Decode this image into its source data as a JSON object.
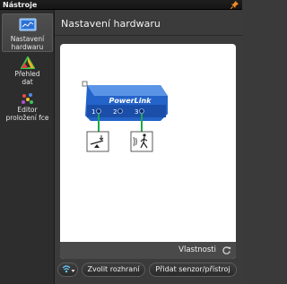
{
  "panel": {
    "title": "Nástroje"
  },
  "sidebar": {
    "items": [
      {
        "label": "Nastavení hardwaru",
        "icon": "hardware-settings-icon",
        "active": true
      },
      {
        "label": "Přehled dat",
        "icon": "data-overview-icon",
        "active": false
      },
      {
        "label": "Editor proložení fce",
        "icon": "curve-fit-editor-icon",
        "active": false
      }
    ]
  },
  "main": {
    "title": "Nastavení hardwaru",
    "device": {
      "name": "PowerLink",
      "ports": [
        "1",
        "2",
        "3"
      ],
      "sensors": [
        {
          "port": "1",
          "icon": "force-sensor-icon"
        },
        {
          "port": "3",
          "icon": "motion-detector-icon"
        }
      ]
    },
    "properties_label": "Vlastnosti"
  },
  "footer": {
    "wireless_icon": "wireless-icon",
    "choose_interface": "Zvolit rozhraní",
    "add_sensor": "Přidat senzor/přístroj"
  },
  "colors": {
    "accent": "#f08a24",
    "device_blue": "#2463c9",
    "connector_green": "#1fa84a"
  }
}
